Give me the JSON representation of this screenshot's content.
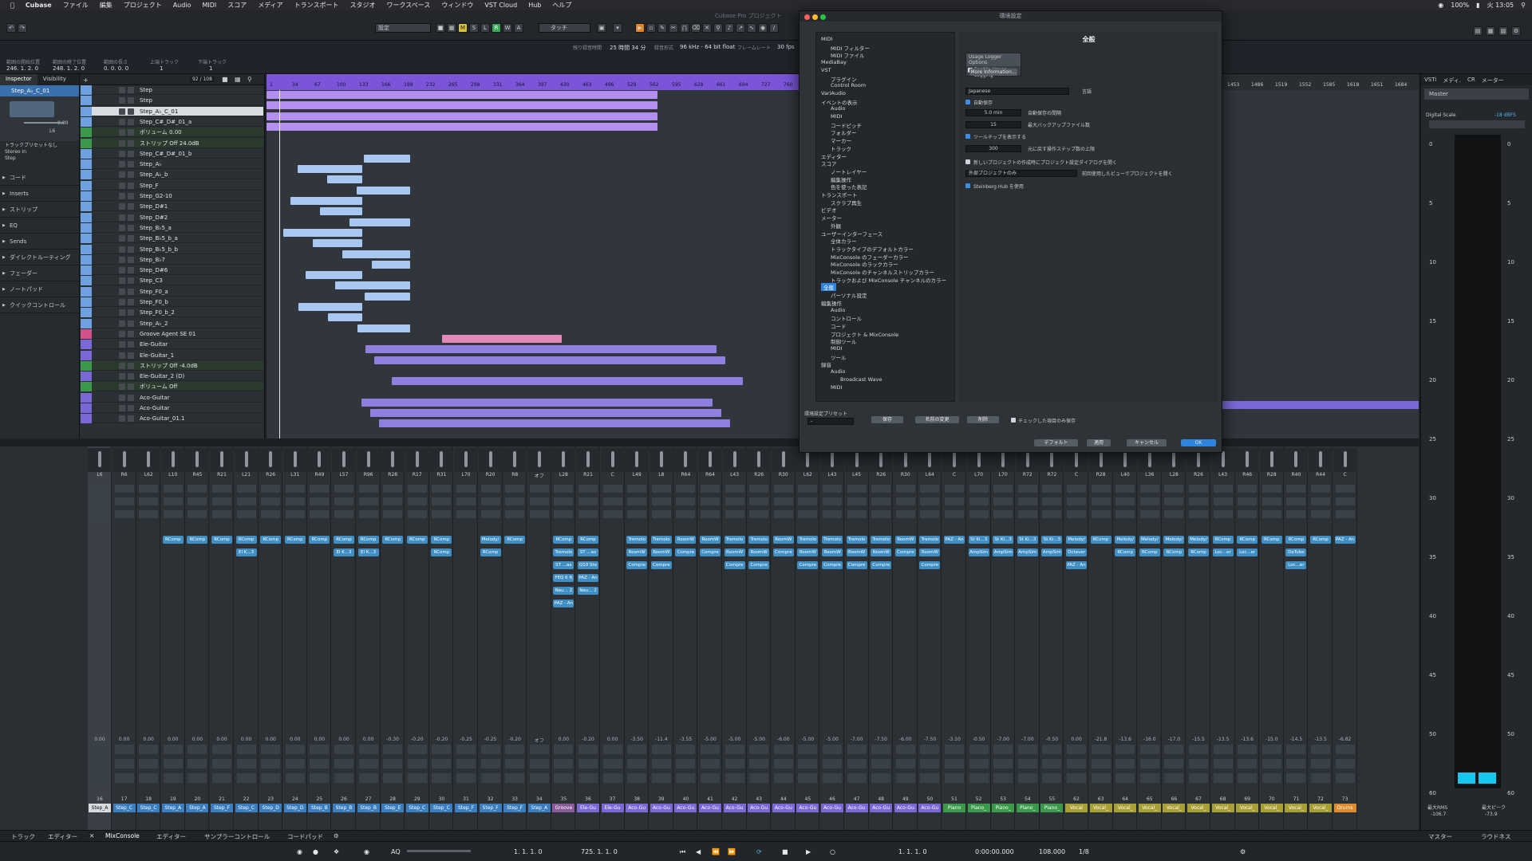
{
  "menubar": {
    "app": "Cubase",
    "items": [
      "ファイル",
      "編集",
      "プロジェクト",
      "Audio",
      "MIDI",
      "スコア",
      "メディア",
      "トランスポート",
      "スタジオ",
      "ワークスペース",
      "ウィンドウ",
      "VST Cloud",
      "Hub",
      "ヘルプ"
    ],
    "battery": "100%",
    "clock": "火 13:05"
  },
  "toolbar": {
    "preset": "設定",
    "mode": "タッチ",
    "window_title": "Cubase Pro プロジェクト",
    "buttons": [
      "M",
      "S",
      "L",
      "R",
      "W",
      "A"
    ]
  },
  "infoline": {
    "labels": [
      "範囲の開始位置",
      "範囲の終了位置",
      "範囲の長さ",
      "上端トラック",
      "下端トラック"
    ],
    "values": [
      "246. 1. 2. 0",
      "248. 1. 2. 0",
      "0. 0. 0. 0",
      "1",
      "1"
    ],
    "status": [
      {
        "label": "残り録音時間",
        "value": "25 時間 34 分"
      },
      {
        "label": "録音形式",
        "value": "96 kHz - 64 bit float"
      },
      {
        "label": "フレームレート",
        "value": "30 fps"
      }
    ]
  },
  "inspector": {
    "tabs": [
      "Inspector",
      "Visibility"
    ],
    "track": "Step_A♭_C_01",
    "volume": "0.00",
    "pan": "L6",
    "routing": [
      "トラックプリセットなし",
      "Stereo In",
      "Step"
    ],
    "sections": [
      "コード",
      "Inserts",
      "ストリップ",
      "EQ",
      "Sends",
      "ダイレクトルーティング",
      "フェーダー",
      "ノートパッド",
      "クイックコントロール"
    ]
  },
  "tracklist": {
    "counter": "92 / 108",
    "tracks": [
      {
        "name": "Step",
        "color": "#6fa0e0"
      },
      {
        "name": "Step",
        "color": "#6fa0e0"
      },
      {
        "name": "Step_A♭_C_01",
        "color": "#6fa0e0",
        "selected": true
      },
      {
        "name": "Step_C#_D#_01_a",
        "color": "#6fa0e0"
      },
      {
        "name": "ボリューム   0.00",
        "color": "#3a9a4a",
        "sub": true
      },
      {
        "name": "ストリップ   Off   24.0dB",
        "color": "#3a9a4a",
        "sub": true
      },
      {
        "name": "Step_C#_D#_01_b",
        "color": "#6fa0e0"
      },
      {
        "name": "Step_A♭",
        "color": "#6fa0e0"
      },
      {
        "name": "Step_A♭_b",
        "color": "#6fa0e0"
      },
      {
        "name": "Step_F",
        "color": "#6fa0e0"
      },
      {
        "name": "Step_G2-10",
        "color": "#6fa0e0"
      },
      {
        "name": "Step_D#1",
        "color": "#6fa0e0"
      },
      {
        "name": "Step_D#2",
        "color": "#6fa0e0"
      },
      {
        "name": "Step_B♭5_a",
        "color": "#6fa0e0"
      },
      {
        "name": "Step_B♭5_b_a",
        "color": "#6fa0e0"
      },
      {
        "name": "Step_B♭5_b_b",
        "color": "#6fa0e0"
      },
      {
        "name": "Step_B♭7",
        "color": "#6fa0e0"
      },
      {
        "name": "Step_D#6",
        "color": "#6fa0e0"
      },
      {
        "name": "Step_C3",
        "color": "#6fa0e0"
      },
      {
        "name": "Step_F0_a",
        "color": "#6fa0e0"
      },
      {
        "name": "Step_F0_b",
        "color": "#6fa0e0"
      },
      {
        "name": "Step_F0_b_2",
        "color": "#6fa0e0"
      },
      {
        "name": "Step_A♭_2",
        "color": "#6fa0e0"
      },
      {
        "name": "Groove Agent SE 01",
        "color": "#d4528a"
      },
      {
        "name": "Ele-Guitar",
        "color": "#7b68d8"
      },
      {
        "name": "Ele-Guitar_1",
        "color": "#7b68d8"
      },
      {
        "name": "ストリップ   Off   -4.0dB",
        "color": "#3a9a4a",
        "sub": true
      },
      {
        "name": "Ele-Guitar_2 (D)",
        "color": "#7b68d8"
      },
      {
        "name": "ボリューム   Off",
        "color": "#3a9a4a",
        "sub": true
      },
      {
        "name": "Aco-Guitar",
        "color": "#7b68d8"
      },
      {
        "name": "Aco-Guitar",
        "color": "#7b68d8"
      },
      {
        "name": "Aco-Guitar_01.1",
        "color": "#7b68d8"
      }
    ]
  },
  "ruler": {
    "marks": [
      "1",
      "34",
      "67",
      "100",
      "133",
      "166",
      "199",
      "232",
      "265",
      "298",
      "331",
      "364",
      "397",
      "430",
      "463",
      "496",
      "529",
      "562",
      "595",
      "628",
      "661",
      "694",
      "727",
      "760"
    ],
    "marks_right": [
      "1453",
      "1486",
      "1519",
      "1552",
      "1585",
      "1618",
      "1651",
      "1684"
    ]
  },
  "preferences": {
    "window_title": "環境設定",
    "section_title": "全般",
    "tree": [
      {
        "label": "MIDI",
        "level": 0
      },
      {
        "label": "MIDI フィルター",
        "level": 1
      },
      {
        "label": "MIDI ファイル",
        "level": 1
      },
      {
        "label": "MediaBay",
        "level": 0
      },
      {
        "label": "VST",
        "level": 0
      },
      {
        "label": "プラグイン",
        "level": 1
      },
      {
        "label": "Control Room",
        "level": 1
      },
      {
        "label": "VariAudio",
        "level": 0
      },
      {
        "label": "イベントの表示",
        "level": 0
      },
      {
        "label": "Audio",
        "level": 1
      },
      {
        "label": "MIDI",
        "level": 1
      },
      {
        "label": "コードピッチ",
        "level": 1
      },
      {
        "label": "フォルダー",
        "level": 1
      },
      {
        "label": "マーカー",
        "level": 1
      },
      {
        "label": "トラック",
        "level": 1
      },
      {
        "label": "エディター",
        "level": 0
      },
      {
        "label": "スコア",
        "level": 0
      },
      {
        "label": "ノートレイヤー",
        "level": 1
      },
      {
        "label": "編集操作",
        "level": 1
      },
      {
        "label": "色を使った表記",
        "level": 1
      },
      {
        "label": "トランスポート",
        "level": 0
      },
      {
        "label": "スクラブ再生",
        "level": 1
      },
      {
        "label": "ビデオ",
        "level": 0
      },
      {
        "label": "メーター",
        "level": 0
      },
      {
        "label": "外観",
        "level": 1
      },
      {
        "label": "ユーザーインターフェース",
        "level": 0
      },
      {
        "label": "全体カラー",
        "level": 1
      },
      {
        "label": "トラックタイプのデフォルトカラー",
        "level": 1
      },
      {
        "label": "MixConsole のフェーダーカラー",
        "level": 1
      },
      {
        "label": "MixConsole のラックカラー",
        "level": 1
      },
      {
        "label": "MixConsole のチャンネルストリップカラー",
        "level": 1
      },
      {
        "label": "トラックおよび MixConsole チャンネルのカラー",
        "level": 1
      },
      {
        "label": "全般",
        "level": 0,
        "selected": true
      },
      {
        "label": "パーソナル設定",
        "level": 1
      },
      {
        "label": "編集操作",
        "level": 0
      },
      {
        "label": "Audio",
        "level": 1
      },
      {
        "label": "コントロール",
        "level": 1
      },
      {
        "label": "コード",
        "level": 1
      },
      {
        "label": "プロジェクト & MixConsole",
        "level": 1
      },
      {
        "label": "制御ツール",
        "level": 1
      },
      {
        "label": "MIDI",
        "level": 1
      },
      {
        "label": "ツール",
        "level": 1
      },
      {
        "label": "録音",
        "level": 0
      },
      {
        "label": "Audio",
        "level": 1
      },
      {
        "label": "Broadcast Wave",
        "level": 2
      },
      {
        "label": "MIDI",
        "level": 1
      }
    ],
    "usage_logger_title": "Usage Logger Options",
    "enable_usage_logging": "Enable Usage Logging",
    "more_info": "More Information...",
    "language_value": "Japanese",
    "language_label": "言語",
    "autosave_label": "自動保存",
    "autosave_interval_value": "5.0 min",
    "autosave_interval_label": "自動保存の間隔",
    "backup_count_value": "15",
    "backup_count_label": "最大バックアップファイル数",
    "tooltips_label": "ツールチップを表示する",
    "undo_steps_value": "300",
    "undo_steps_label": "元に戻す操作ステップ数の上限",
    "project_settings_label": "新しいプロジェクトの作成時にプロジェクト設定ダイアログを開く",
    "external_project_value": "外部プロジェクトのみ",
    "external_project_label": "前回使用したビューでプロジェクトを開く",
    "hub_label": "Steinberg Hub を使用",
    "presets_label": "環境設定プリセット",
    "preset_value": "-",
    "save_button": "保存",
    "rename_button": "名前の変更",
    "delete_button": "削除",
    "checked_only_label": "チェックした項目のみ保存",
    "default_button": "デフォルト",
    "apply_button": "適用",
    "cancel_button": "キャンセル",
    "ok_button": "OK"
  },
  "right_rack": {
    "tabs": [
      "VSTi",
      "メディ.",
      "CR",
      "メーター"
    ],
    "master": "Master",
    "scale_label": "Digital Scale",
    "scale_value": "-18 dBFS",
    "ticks": [
      "0",
      "5",
      "10",
      "15",
      "20",
      "25",
      "30",
      "35",
      "40",
      "45",
      "50",
      "60"
    ],
    "rms_label": "最大RMS",
    "rms_value": "-106.7",
    "peak_label": "最大ピーク",
    "peak_value": "-73.9"
  },
  "mixer": {
    "channels": [
      {
        "pan": "L6",
        "db": "0.00",
        "num": "16",
        "name": "Step_A",
        "color": "#d8dce0",
        "slots": []
      },
      {
        "pan": "R6",
        "db": "0.00",
        "num": "17",
        "name": "Step_C",
        "color": "#3b7ec0",
        "slots": []
      },
      {
        "pan": "L62",
        "db": "0.00",
        "num": "18",
        "name": "Step_C",
        "color": "#3b7ec0",
        "slots": []
      },
      {
        "pan": "L10",
        "db": "0.00",
        "num": "19",
        "name": "Step_A",
        "color": "#3b7ec0",
        "slots": [
          "RComp"
        ]
      },
      {
        "pan": "R45",
        "db": "0.00",
        "num": "20",
        "name": "Step_A",
        "color": "#3b7ec0",
        "slots": [
          "RComp"
        ]
      },
      {
        "pan": "R21",
        "db": "0.00",
        "num": "21",
        "name": "Step_F",
        "color": "#3b7ec0",
        "slots": [
          "RComp"
        ]
      },
      {
        "pan": "L21",
        "db": "0.00",
        "num": "22",
        "name": "Step_C",
        "color": "#3b7ec0",
        "slots": [
          "RComp",
          "El K...3"
        ]
      },
      {
        "pan": "R26",
        "db": "0.00",
        "num": "23",
        "name": "Step_D",
        "color": "#3b7ec0",
        "slots": [
          "RComp"
        ]
      },
      {
        "pan": "L31",
        "db": "0.00",
        "num": "24",
        "name": "Step_D",
        "color": "#3b7ec0",
        "slots": [
          "RComp"
        ]
      },
      {
        "pan": "R49",
        "db": "0.00",
        "num": "25",
        "name": "Step_B",
        "color": "#3b7ec0",
        "slots": [
          "RComp"
        ]
      },
      {
        "pan": "L57",
        "db": "0.00",
        "num": "26",
        "name": "Step_B",
        "color": "#3b7ec0",
        "slots": [
          "RComp",
          "El K...3"
        ]
      },
      {
        "pan": "R96",
        "db": "0.00",
        "num": "27",
        "name": "Step_B",
        "color": "#3b7ec0",
        "slots": [
          "RComp",
          "El K...3"
        ]
      },
      {
        "pan": "R28",
        "db": "-0.30",
        "num": "28",
        "name": "Step_E",
        "color": "#3b7ec0",
        "slots": [
          "RComp"
        ]
      },
      {
        "pan": "R17",
        "db": "-0.20",
        "num": "29",
        "name": "Step_C",
        "color": "#3b7ec0",
        "slots": [
          "RComp"
        ]
      },
      {
        "pan": "R31",
        "db": "-0.20",
        "num": "30",
        "name": "Step_C",
        "color": "#3b7ec0",
        "slots": [
          "RComp",
          "RComp"
        ]
      },
      {
        "pan": "L70",
        "db": "-0.25",
        "num": "31",
        "name": "Step_F",
        "color": "#3b7ec0",
        "slots": []
      },
      {
        "pan": "R20",
        "db": "-0.25",
        "num": "32",
        "name": "Step_F",
        "color": "#3b7ec0",
        "slots": [
          "Melody/",
          "RComp"
        ]
      },
      {
        "pan": "R8",
        "db": "-0.20",
        "num": "33",
        "name": "Step_F",
        "color": "#3b7ec0",
        "slots": [
          "RComp"
        ]
      },
      {
        "pan": "オフ",
        "db": "オフ",
        "num": "34",
        "name": "Step_A",
        "color": "#3b7ec0",
        "slots": []
      },
      {
        "pan": "L28",
        "db": "0.00",
        "num": "35",
        "name": "Groove",
        "color": "#8a5a9a",
        "slots": [
          "RComp",
          "Tremolo",
          "ST ...ax",
          "FEQ 6 ft",
          "Neu... 2",
          "PAZ - An"
        ]
      },
      {
        "pan": "R21",
        "db": "-0.20",
        "num": "36",
        "name": "Ele-Gu",
        "color": "#7b68d8",
        "slots": [
          "RComp",
          "ST ...ax",
          "Q10 Ste",
          "PAZ - An",
          "Neu... 2"
        ]
      },
      {
        "pan": "C",
        "db": "0.00",
        "num": "37",
        "name": "Ele-Gu",
        "color": "#7b68d8",
        "slots": []
      },
      {
        "pan": "L49",
        "db": "-3.50",
        "num": "38",
        "name": "Aco-Gu",
        "color": "#7b68d8",
        "slots": [
          "Tremolo",
          "RoomW",
          "Compre"
        ]
      },
      {
        "pan": "L8",
        "db": "-11.4",
        "num": "39",
        "name": "Aco-Gu",
        "color": "#7b68d8",
        "slots": [
          "Tremolo",
          "RoomW",
          "Compre"
        ]
      },
      {
        "pan": "R64",
        "db": "-3.55",
        "num": "40",
        "name": "Aco-Gu",
        "color": "#7b68d8",
        "slots": [
          "RoomW",
          "Compre"
        ]
      },
      {
        "pan": "R64",
        "db": "-5.00",
        "num": "41",
        "name": "Aco-Gu",
        "color": "#7b68d8",
        "slots": [
          "RoomW",
          "Compre"
        ]
      },
      {
        "pan": "L43",
        "db": "-5.00",
        "num": "42",
        "name": "Aco-Gu",
        "color": "#7b68d8",
        "slots": [
          "Tremolo",
          "RoomW",
          "Compre"
        ]
      },
      {
        "pan": "R26",
        "db": "-5.00",
        "num": "43",
        "name": "Aco-Gu",
        "color": "#7b68d8",
        "slots": [
          "Tremolo",
          "RoomW",
          "Compre"
        ]
      },
      {
        "pan": "R30",
        "db": "-6.00",
        "num": "44",
        "name": "Aco-Gu",
        "color": "#7b68d8",
        "slots": [
          "RoomW",
          "Compre"
        ]
      },
      {
        "pan": "L62",
        "db": "-5.00",
        "num": "45",
        "name": "Aco-Gu",
        "color": "#7b68d8",
        "slots": [
          "Tremolo",
          "RoomW",
          "Compre"
        ]
      },
      {
        "pan": "L43",
        "db": "-5.00",
        "num": "46",
        "name": "Aco-Gu",
        "color": "#7b68d8",
        "slots": [
          "Tremolo",
          "RoomW",
          "Compre"
        ]
      },
      {
        "pan": "L45",
        "db": "-7.00",
        "num": "47",
        "name": "Aco-Gu",
        "color": "#7b68d8",
        "slots": [
          "Tremolo",
          "RoomW",
          "Compre"
        ]
      },
      {
        "pan": "R26",
        "db": "-7.50",
        "num": "48",
        "name": "Aco-Gu",
        "color": "#7b68d8",
        "slots": [
          "Tremolo",
          "RoomW",
          "Compre"
        ]
      },
      {
        "pan": "R30",
        "db": "-6.00",
        "num": "49",
        "name": "Aco-Gu",
        "color": "#7b68d8",
        "slots": [
          "RoomW",
          "Compre"
        ]
      },
      {
        "pan": "L64",
        "db": "-7.50",
        "num": "50",
        "name": "Aco-Gu",
        "color": "#7b68d8",
        "slots": [
          "Tremolo",
          "RoomW",
          "Compre"
        ]
      },
      {
        "pan": "C",
        "db": "-3.10",
        "num": "51",
        "name": "Piano",
        "color": "#3a9a4a",
        "slots": [
          "PAZ - An"
        ]
      },
      {
        "pan": "L70",
        "db": "-0.50",
        "num": "52",
        "name": "Piano_",
        "color": "#3a9a4a",
        "slots": [
          "St Ki...3",
          "AmpSim"
        ]
      },
      {
        "pan": "L70",
        "db": "-7.00",
        "num": "53",
        "name": "Piano_",
        "color": "#3a9a4a",
        "slots": [
          "St Ki...3",
          "AmpSim"
        ]
      },
      {
        "pan": "R72",
        "db": "-7.00",
        "num": "54",
        "name": "Piano_",
        "color": "#3a9a4a",
        "slots": [
          "St Ki...3",
          "AmpSim"
        ]
      },
      {
        "pan": "R72",
        "db": "-0.50",
        "num": "55",
        "name": "Piano_",
        "color": "#3a9a4a",
        "slots": [
          "St Ki...3",
          "AmpSim"
        ]
      },
      {
        "pan": "C",
        "db": "0.00",
        "num": "62",
        "name": "Vocal",
        "color": "#a8a035",
        "slots": [
          "Melody/",
          "Octaver",
          "PAZ - An"
        ]
      },
      {
        "pan": "R28",
        "db": "-21.8",
        "num": "63",
        "name": "Vocal_",
        "color": "#a8a035",
        "slots": [
          "RComp"
        ]
      },
      {
        "pan": "L40",
        "db": "-13.6",
        "num": "64",
        "name": "Vocal_",
        "color": "#a8a035",
        "slots": [
          "Melody/",
          "RComp"
        ]
      },
      {
        "pan": "L36",
        "db": "-16.0",
        "num": "65",
        "name": "Vocal_",
        "color": "#a8a035",
        "slots": [
          "Melody/",
          "RComp"
        ]
      },
      {
        "pan": "L28",
        "db": "-17.0",
        "num": "66",
        "name": "Vocal_",
        "color": "#a8a035",
        "slots": [
          "Melody/",
          "RComp"
        ]
      },
      {
        "pan": "R26",
        "db": "-15.5",
        "num": "67",
        "name": "Vocal_",
        "color": "#a8a035",
        "slots": [
          "Melody/",
          "RComp"
        ]
      },
      {
        "pan": "L43",
        "db": "-13.5",
        "num": "68",
        "name": "Vocal_",
        "color": "#a8a035",
        "slots": [
          "RComp",
          "Loc...er"
        ]
      },
      {
        "pan": "R46",
        "db": "-13.6",
        "num": "69",
        "name": "Vocal_",
        "color": "#a8a035",
        "slots": [
          "RComp",
          "Loc...er"
        ]
      },
      {
        "pan": "R28",
        "db": "-15.0",
        "num": "70",
        "name": "Vocal_",
        "color": "#a8a035",
        "slots": [
          "RComp"
        ]
      },
      {
        "pan": "R40",
        "db": "-14.5",
        "num": "71",
        "name": "Vocal_",
        "color": "#a8a035",
        "slots": [
          "RComp",
          "DeTube",
          "Loc...er"
        ]
      },
      {
        "pan": "R44",
        "db": "-13.5",
        "num": "72",
        "name": "Vocal_",
        "color": "#a8a035",
        "slots": [
          "RComp"
        ]
      },
      {
        "pan": "C",
        "db": "-6.82",
        "num": "73",
        "name": "Drums",
        "color": "#e08a2a",
        "slots": [
          "PAZ - An"
        ]
      }
    ]
  },
  "bottom_tabs": {
    "left": [
      "トラック",
      "エディター"
    ],
    "lower": [
      "MixConsole",
      "エディター",
      "サンプラーコントロール",
      "コードパッド"
    ],
    "right": [
      "マスター",
      "ラウドネス"
    ]
  },
  "transport": {
    "left_locator": "1. 1. 1. 0",
    "right_locator": "725. 1. 1. 0",
    "position": "1. 1. 1. 0",
    "time": "0:00:00.000",
    "tempo": "108.000",
    "signature": "1/8"
  }
}
